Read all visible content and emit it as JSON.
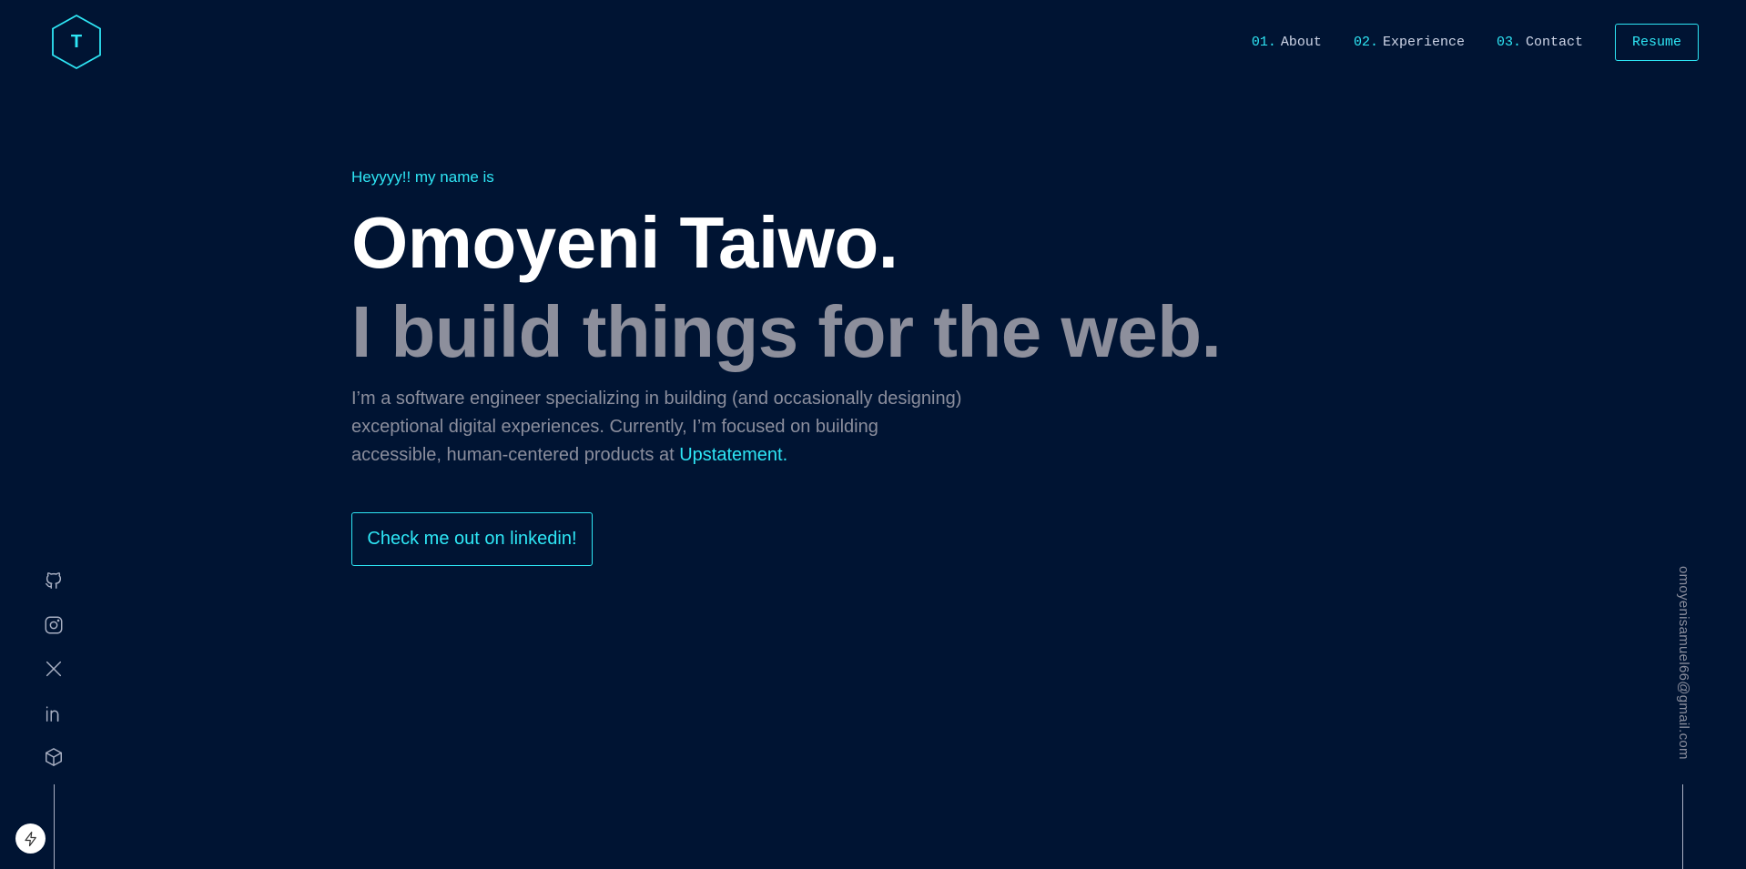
{
  "header": {
    "logo_letter": "T",
    "nav": [
      {
        "num": "01.",
        "label": "About"
      },
      {
        "num": "02.",
        "label": "Experience"
      },
      {
        "num": "03.",
        "label": "Contact"
      }
    ],
    "resume_label": "Resume"
  },
  "hero": {
    "greeting": "Heyyyy!! my name is",
    "name": "Omoyeni Taiwo.",
    "tagline": "I build things for the web.",
    "bio_line1": "I’m a software engineer specializing in building (and occasionally designing)",
    "bio_line2": "exceptional digital experiences. Currently, I’m focused on building",
    "bio_line3": "accessible, human-centered products at",
    "bio_link": "Upstatement.",
    "cta_label": "Check me out on linkedin!"
  },
  "socials": [
    {
      "icon": "github-icon"
    },
    {
      "icon": "instagram-icon"
    },
    {
      "icon": "x-icon"
    },
    {
      "icon": "linkedin-icon"
    },
    {
      "icon": "codepen-icon"
    }
  ],
  "email": "omoyenisamuel66@gmail.com",
  "colors": {
    "background": "#001433",
    "accent": "#2ee6f5",
    "heading": "#ffffff",
    "muted": "#8d8f9c"
  }
}
